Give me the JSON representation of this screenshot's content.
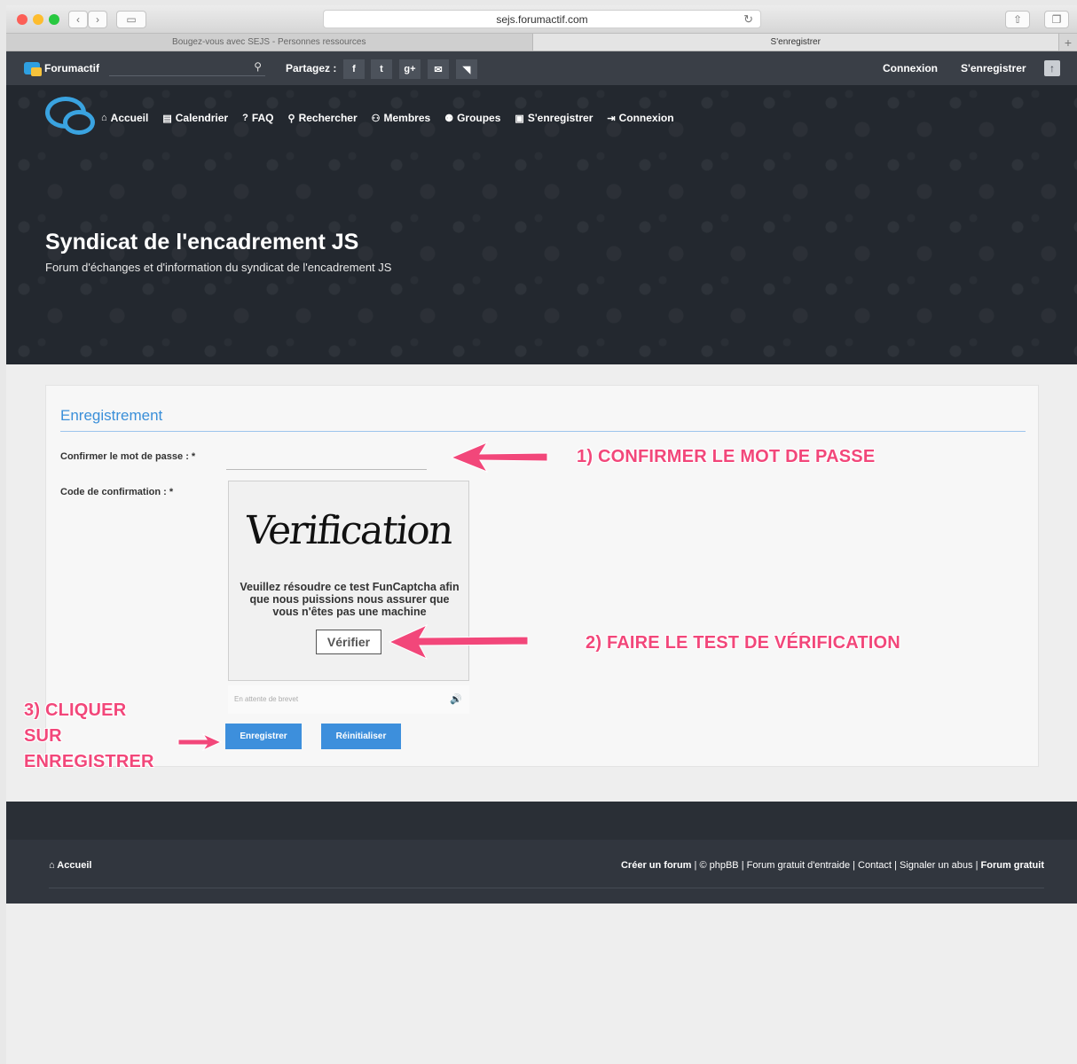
{
  "browser": {
    "url": "sejs.forumactif.com",
    "tabs": [
      {
        "label": "Bougez-vous avec SEJS - Personnes ressources",
        "active": false
      },
      {
        "label": "S'enregistrer",
        "active": true
      }
    ],
    "new_tab_symbol": "+"
  },
  "topbar": {
    "brand": "Forumactif",
    "share_label": "Partagez :",
    "social_icons": [
      "facebook-icon",
      "twitter-icon",
      "googleplus-icon",
      "mail-icon",
      "rss-icon"
    ],
    "social_glyphs": [
      "f",
      "t",
      "g+",
      "✉",
      "◥"
    ],
    "login": "Connexion",
    "register": "S'enregistrer",
    "up_glyph": "↑"
  },
  "nav": {
    "items": [
      {
        "label": "Accueil",
        "icon": "home-icon",
        "glyph": "⌂"
      },
      {
        "label": "Calendrier",
        "icon": "calendar-icon",
        "glyph": "▤"
      },
      {
        "label": "FAQ",
        "icon": "question-icon",
        "glyph": "?"
      },
      {
        "label": "Rechercher",
        "icon": "search-icon",
        "glyph": "⚲"
      },
      {
        "label": "Membres",
        "icon": "members-icon",
        "glyph": "⚇"
      },
      {
        "label": "Groupes",
        "icon": "groups-icon",
        "glyph": "⚉"
      },
      {
        "label": "S'enregistrer",
        "icon": "register-icon",
        "glyph": "▣"
      },
      {
        "label": "Connexion",
        "icon": "login-icon",
        "glyph": "⇥"
      }
    ]
  },
  "hero": {
    "title": "Syndicat de l'encadrement JS",
    "subtitle": "Forum d'échanges et d'information du syndicat de l'encadrement JS"
  },
  "form": {
    "title": "Enregistrement",
    "confirm_password_label": "Confirmer le mot de passe : *",
    "confirmation_code_label": "Code de confirmation : *",
    "captcha_word": "Verification",
    "captcha_text": "Veuillez résoudre ce test FunCaptcha afin que nous puissions nous assurer que vous n'êtes pas une machine",
    "captcha_button": "Vérifier",
    "audio_status": "En attente de brevet",
    "submit": "Enregistrer",
    "reset": "Réinitialiser"
  },
  "annotations": {
    "step1": "1) CONFIRMER LE MOT DE PASSE",
    "step2": "2) FAIRE LE TEST DE VÉRIFICATION",
    "step3_line1": "3) CLIQUER",
    "step3_line2": "SUR",
    "step3_line3": "ENREGISTRER"
  },
  "footer": {
    "home": "Accueil",
    "create_forum": "Créer un forum",
    "phpbb": "© phpBB",
    "help": "Forum gratuit d'entraide",
    "contact": "Contact",
    "abuse": "Signaler un abus",
    "free_forum": "Forum gratuit",
    "sep": "|"
  },
  "colors": {
    "accent": "#3d8fdc",
    "annotation": "#f2477a",
    "topbar": "#3a3f47"
  }
}
